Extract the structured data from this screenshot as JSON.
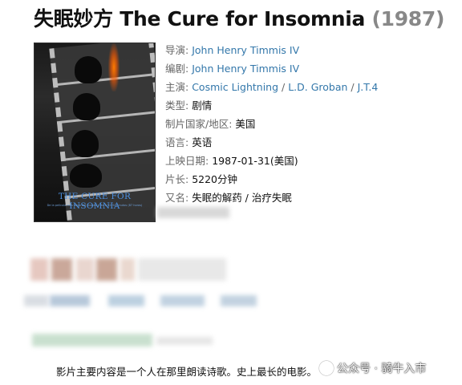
{
  "movie": {
    "title": "失眠妙方 The Cure for Insomnia",
    "year": "(1987)",
    "poster": {
      "title_text": "THE CURE FOR INSOMNIA",
      "subtitle_text": "De la película más larga del mundo y dura 5220 minutos (87 horas)"
    }
  },
  "info": {
    "director": {
      "label": "导演:",
      "names": [
        "John Henry Timmis IV"
      ]
    },
    "writer": {
      "label": "编剧:",
      "names": [
        "John Henry Timmis IV"
      ]
    },
    "cast": {
      "label": "主演:",
      "names": [
        "Cosmic Lightning",
        "L.D. Groban",
        "J.T.4"
      ],
      "separator": " / "
    },
    "genre": {
      "label": "类型:",
      "value": "剧情"
    },
    "country": {
      "label": "制片国家/地区:",
      "value": "美国"
    },
    "language": {
      "label": "语言:",
      "value": "英语"
    },
    "release": {
      "label": "上映日期:",
      "value": "1987-01-31(美国)"
    },
    "runtime": {
      "label": "片长:",
      "value": "5220分钟"
    },
    "aka": {
      "label": "又名:",
      "value": "失眠的解药 / 治疗失眠"
    }
  },
  "description": "影片主要内容是一个人在那里朗读诗歌。史上最长的电影。",
  "watermark": {
    "text": "公众号 · 骑牛入市"
  },
  "colors": {
    "link": "#3377aa",
    "label": "#666666",
    "year": "#888888"
  }
}
